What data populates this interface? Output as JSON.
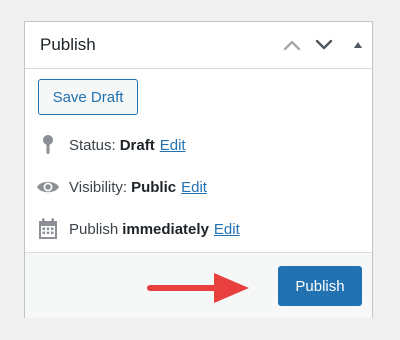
{
  "panel": {
    "title": "Publish"
  },
  "actions": {
    "save_draft_label": "Save Draft",
    "publish_label": "Publish"
  },
  "status": {
    "label": "Status:",
    "value": "Draft",
    "edit_label": "Edit"
  },
  "visibility": {
    "label": "Visibility:",
    "value": "Public",
    "edit_label": "Edit"
  },
  "schedule": {
    "label": "Publish",
    "value": "immediately",
    "edit_label": "Edit"
  },
  "icons": {
    "move_up": "chevron-up-icon",
    "move_down": "chevron-down-icon",
    "toggle": "triangle-up-icon",
    "status": "pin-icon",
    "visibility": "eye-icon",
    "schedule": "calendar-icon"
  },
  "colors": {
    "accent": "#2271b1",
    "arrow": "#e8403f",
    "background": "#f0f0f1",
    "footer": "#f6f7f7"
  }
}
